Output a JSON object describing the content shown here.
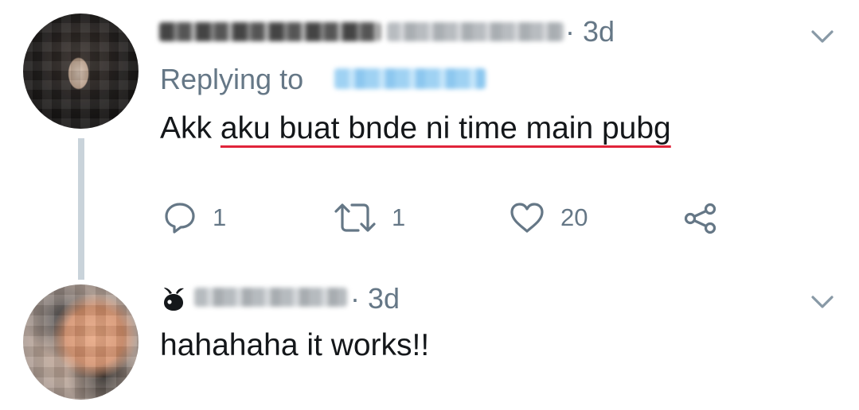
{
  "tweet1": {
    "time": "3d",
    "replying_label": "Replying to",
    "text_prefix": "Akk ",
    "text_highlight": "aku buat bnde ni time main pubg",
    "actions": {
      "reply_count": "1",
      "retweet_count": "1",
      "like_count": "20"
    }
  },
  "tweet2": {
    "time": "3d",
    "text": "hahahaha it works!!"
  },
  "colors": {
    "text_primary": "#14171a",
    "text_secondary": "#657786",
    "mention_blue": "#1da1f2",
    "underline_red": "#e0243a",
    "thread_line": "#c9d3da"
  },
  "icons": [
    "reply-icon",
    "retweet-icon",
    "like-icon",
    "share-icon",
    "chevron-down-icon",
    "emoji-badge-icon"
  ]
}
